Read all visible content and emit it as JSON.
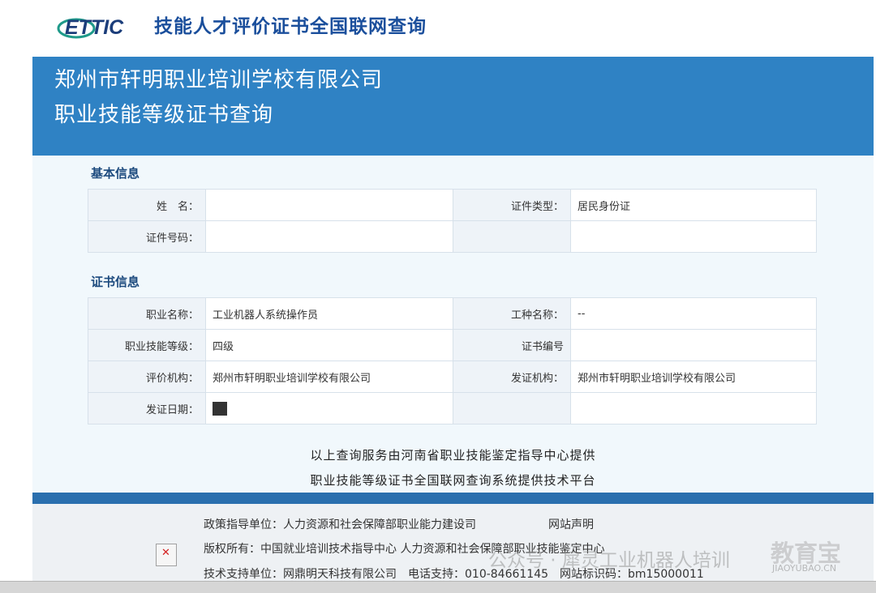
{
  "header": {
    "logo_text": "ETTIC",
    "site_title": "技能人才评价证书全国联网查询"
  },
  "banner": {
    "line1": "郑州市轩明职业培训学校有限公司",
    "line2": "职业技能等级证书查询"
  },
  "basic_info": {
    "title": "基本信息",
    "rows": [
      {
        "label1": "姓　名：",
        "value1": "",
        "label2": "证件类型：",
        "value2": "居民身份证"
      },
      {
        "label1": "证件号码：",
        "value1": "",
        "label2": "",
        "value2": ""
      }
    ]
  },
  "cert_info": {
    "title": "证书信息",
    "rows": [
      {
        "label1": "职业名称：",
        "value1": "工业机器人系统操作员",
        "label2": "工种名称：",
        "value2": "--"
      },
      {
        "label1": "职业技能等级：",
        "value1": "四级",
        "label2": "证书编号",
        "value2": ""
      },
      {
        "label1": "评价机构：",
        "value1": "郑州市轩明职业培训学校有限公司",
        "label2": "发证机构：",
        "value2": "郑州市轩明职业培训学校有限公司"
      },
      {
        "label1": "发证日期：",
        "value1": "",
        "label2": "",
        "value2": ""
      }
    ]
  },
  "provider": {
    "line1": "以上查询服务由河南省职业技能鉴定指导中心提供",
    "line2": "职业技能等级证书全国联网查询系统提供技术平台"
  },
  "footer": {
    "line1": "政策指导单位：人力资源和社会保障部职业能力建设司",
    "declaration": "网站声明",
    "line2": "版权所有：中国就业培训技术指导中心 人力资源和社会保障部职业技能鉴定中心",
    "line3": "技术支持单位：网鼎明天科技有限公司　电话支持：010-84661145　网站标识码：bm15000011"
  },
  "watermark": {
    "wechat": "公众号 · 犀灵工业机器人培训",
    "brand": "教育宝",
    "brand_url": "JIAOYUBAO.CN"
  },
  "colors": {
    "banner": "#2f82c4",
    "title": "#1b4f9c",
    "content_bg": "#f1f8fc",
    "footer_bar": "#2a6fae"
  }
}
